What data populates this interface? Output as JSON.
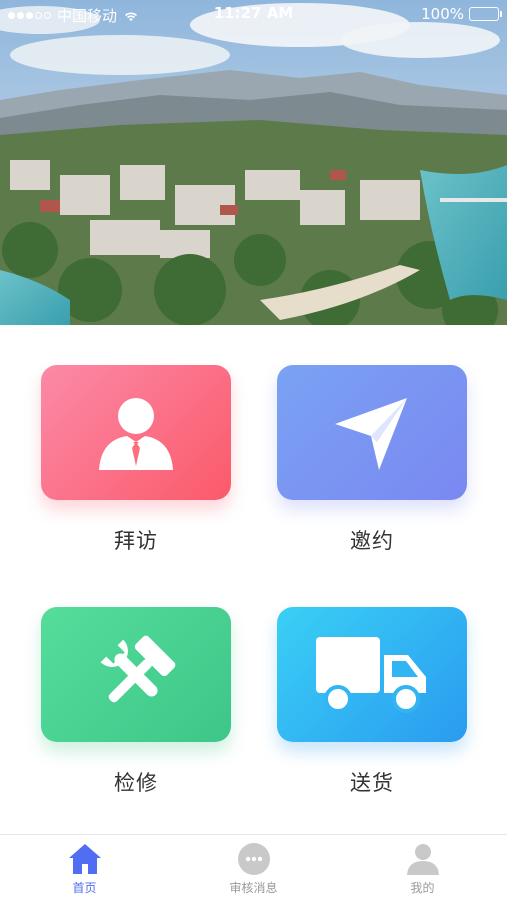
{
  "status_bar": {
    "carrier": "中国移动",
    "time": "11:27 AM",
    "battery": "100%"
  },
  "hero": {
    "image": "city-river-landscape-photo"
  },
  "grid": [
    {
      "label": "拜访",
      "icon": "visitor-icon"
    },
    {
      "label": "邀约",
      "icon": "paper-plane-icon"
    },
    {
      "label": "检修",
      "icon": "wrench-hammer-icon"
    },
    {
      "label": "送货",
      "icon": "delivery-truck-icon"
    }
  ],
  "colors": {
    "visit": "#fb6f7f",
    "invite": "#7a94f3",
    "repair": "#48d191",
    "deliver": "#33b5f3",
    "tab_active": "#4f6ef2",
    "tab_inactive": "#9a9a9a"
  },
  "tabbar": {
    "tabs": [
      {
        "label": "首页",
        "icon": "home-icon",
        "active": true
      },
      {
        "label": "审核消息",
        "icon": "chat-icon",
        "active": false
      },
      {
        "label": "我的",
        "icon": "user-icon",
        "active": false
      }
    ]
  }
}
